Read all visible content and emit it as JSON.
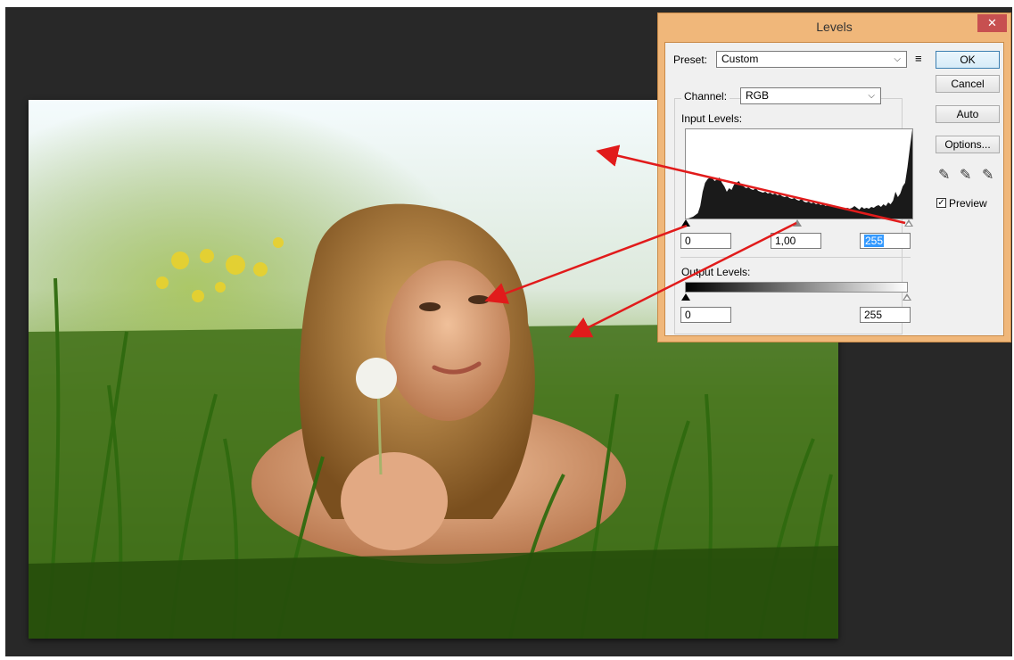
{
  "dialog": {
    "title": "Levels",
    "close_glyph": "✕",
    "preset_label": "Preset:",
    "preset_value": "Custom",
    "preset_menu_icon": "preset-options-icon",
    "channel_label": "Channel:",
    "channel_value": "RGB",
    "input_levels_label": "Input Levels:",
    "input_black": "0",
    "input_gamma": "1,00",
    "input_white": "255",
    "output_levels_label": "Output Levels:",
    "output_black": "0",
    "output_white": "255",
    "buttons": {
      "ok": "OK",
      "cancel": "Cancel",
      "auto": "Auto",
      "options": "Options..."
    },
    "preview_label": "Preview",
    "preview_checked": true
  },
  "colors": {
    "titlebar": "#f0b77a",
    "close": "#c75050",
    "workspace": "#282828",
    "arrow": "#e11b1b",
    "selection": "#3399ff"
  },
  "histogram": [
    0,
    0,
    1,
    2,
    4,
    6,
    14,
    30,
    40,
    44,
    46,
    45,
    42,
    44,
    46,
    40,
    36,
    30,
    34,
    32,
    38,
    40,
    42,
    38,
    36,
    34,
    35,
    33,
    32,
    34,
    31,
    30,
    29,
    30,
    28,
    29,
    27,
    28,
    26,
    27,
    25,
    24,
    25,
    23,
    22,
    23,
    21,
    20,
    22,
    19,
    18,
    19,
    17,
    18,
    16,
    17,
    15,
    16,
    14,
    15,
    14,
    13,
    14,
    12,
    13,
    12,
    11,
    12,
    11,
    12,
    14,
    12,
    10,
    13,
    11,
    12,
    11,
    13,
    12,
    14,
    15,
    13,
    16,
    14,
    18,
    16,
    20,
    30,
    24,
    28,
    36,
    40,
    58,
    80,
    100
  ]
}
